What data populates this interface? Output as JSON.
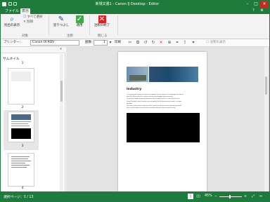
{
  "window": {
    "title": "新規文書1 - Canon IJ Desktop - Editor",
    "minimize_glyph": "–",
    "maximize_glyph": "□",
    "close_glyph": "×"
  },
  "tabs": [
    {
      "label": "ファイル"
    },
    {
      "label": "表示"
    }
  ],
  "tab_icons": {
    "help": "?",
    "settings": "⚙"
  },
  "ribbon": {
    "find_button": "見出の表示",
    "select_all": "すべて選択",
    "delete_label": "削除",
    "group_target": "対象",
    "highlight_button": "塗りつぶし",
    "confirm_button": "適用",
    "group_annotation": "注釈",
    "close_button": "注釈の終了",
    "group_close": "閉じる"
  },
  "toolbar": {
    "printer_label": "プリンター：",
    "printer_value": "Canon IX-RDV",
    "copies_label": "部数：",
    "copies_value": "1",
    "print_button": "印刷",
    "search_label": "注釈の表示"
  },
  "thumbnail_panel": {
    "title": "サムネイル",
    "pages": [
      {
        "number": "1"
      },
      {
        "number": "2"
      },
      {
        "number": "3"
      },
      {
        "number": "4"
      }
    ]
  },
  "document": {
    "heading": "Industry",
    "lines": [
      "The following text cannot be read on the computer screen. However, the language used can be",
      "identified. Please check the sentence and the used language when necessary.",
      "Do you have trouble finding the document that you want to refer to in the shared server?",
      "Using IJ Desktop's search function, you can quickly find the documents you want in a simple",
      "operation.",
      "Let's take a look at how to make use of the search function and current proposal documents!",
      "First, use IJ Desktop's search function to find the document that you want to show."
    ]
  },
  "status": {
    "page_info": "選択ページ：3 / 13",
    "zoom": "45%",
    "zoom_level": 0.45
  },
  "colors": {
    "brand": "#1e7b3c",
    "accent_red": "#e02020"
  }
}
